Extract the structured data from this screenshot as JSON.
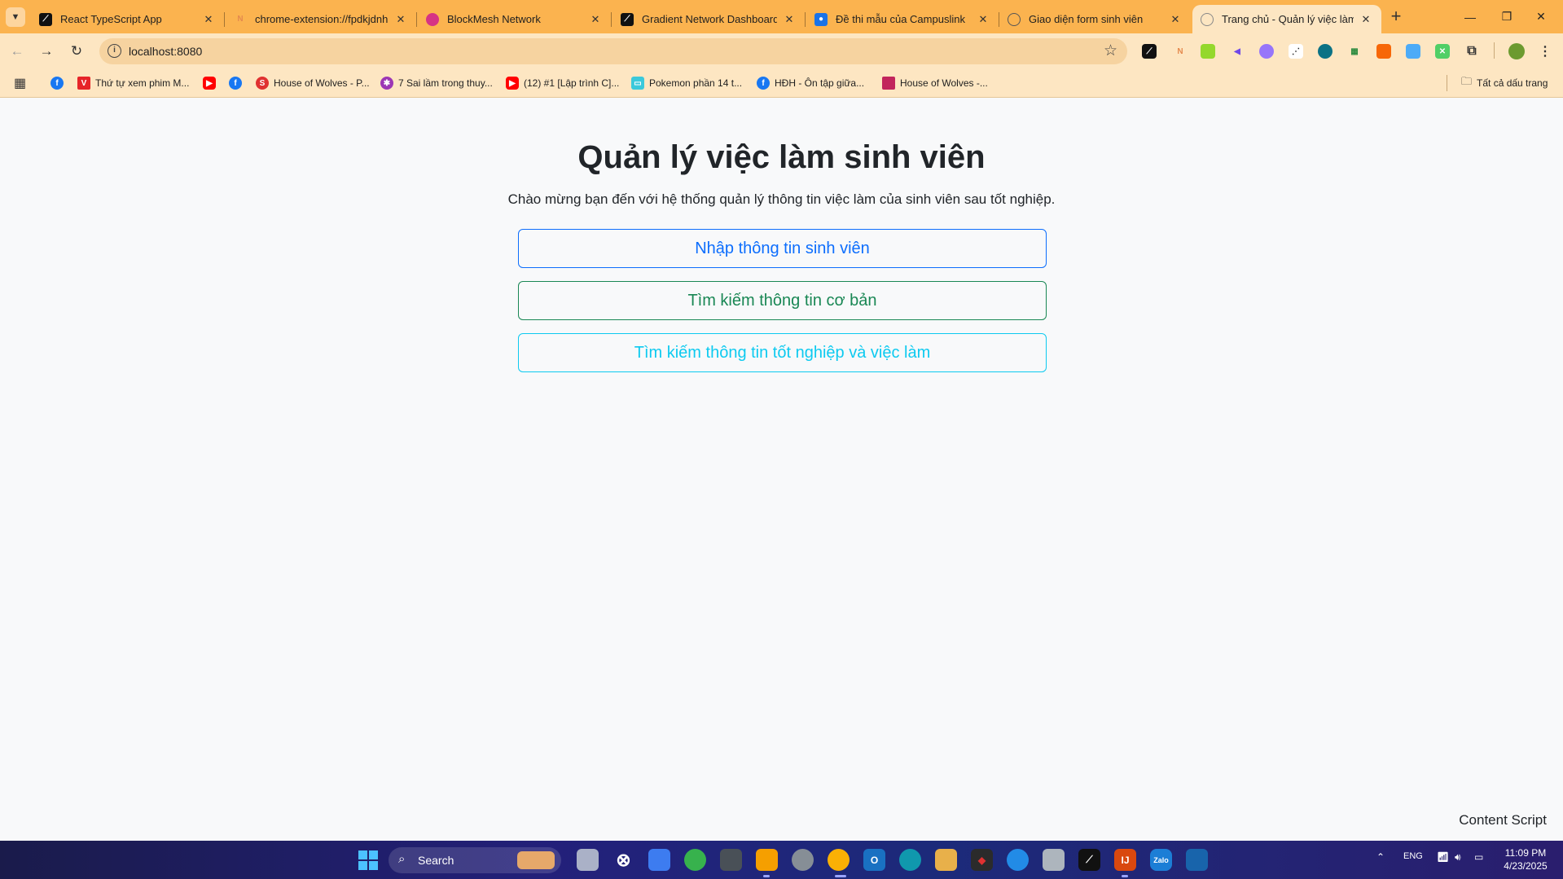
{
  "browser": {
    "tabs": [
      {
        "title": "React TypeScript App",
        "icon": "gradient-logo-icon",
        "color": "#111111"
      },
      {
        "title": "chrome-extension://fpdkjdnhkakefebpekbdhillbhonfjjp",
        "icon": "nodepay-icon",
        "color": "#f0a070"
      },
      {
        "title": "BlockMesh Network",
        "icon": "blockmesh-icon",
        "color": "#d63384"
      },
      {
        "title": "Gradient Network Dashboard",
        "icon": "gradient-logo-icon",
        "color": "#111111"
      },
      {
        "title": "Đề thi mẫu của Campuslink",
        "icon": "contact-icon",
        "color": "#1a73e8"
      },
      {
        "title": "Giao diện form sinh viên",
        "icon": "globe-icon",
        "color": "#666666"
      },
      {
        "title": "Trang chủ - Quản lý việc làm sinh viên",
        "icon": "globe-icon",
        "color": "#666666"
      }
    ],
    "address": "localhost:8080",
    "bookmarks": [
      {
        "label": "",
        "icon": "facebook-icon",
        "color": "#1877f2"
      },
      {
        "label": "Thứ tự xem phim M...",
        "icon": "marvel-icon",
        "color": "#e62429"
      },
      {
        "label": "",
        "icon": "youtube-icon",
        "color": "#ff0000"
      },
      {
        "label": "",
        "icon": "facebook-icon",
        "color": "#1877f2"
      },
      {
        "label": "House of Wolves - P...",
        "icon": "scribd-icon",
        "color": "#e03131"
      },
      {
        "label": "7 Sai lầm trong thuy...",
        "icon": "pinwheel-icon",
        "color": "#9c36b5"
      },
      {
        "label": "(12) #1 [Lập trình C]...",
        "icon": "youtube-icon",
        "color": "#ff0000"
      },
      {
        "label": "Pokemon phần 14 t...",
        "icon": "tv-icon",
        "color": "#3bc9db"
      },
      {
        "label": "HĐH - Ôn tập giữa...",
        "icon": "facebook-icon",
        "color": "#1877f2"
      },
      {
        "label": "House of Wolves -...",
        "icon": "image-icon",
        "color": "#c2255c"
      }
    ],
    "all_bookmarks": "Tất cả dấu trang"
  },
  "page": {
    "title": "Quản lý việc làm sinh viên",
    "welcome": "Chào mừng bạn đến với hệ thống quản lý thông tin việc làm của sinh viên sau tốt nghiệp.",
    "buttons": {
      "enter_info": "Nhập thông tin sinh viên",
      "basic_search": "Tìm kiếm thông tin cơ bản",
      "graduation_search": "Tìm kiếm thông tin tốt nghiệp và việc làm"
    },
    "content_script": "Content Script"
  },
  "taskbar": {
    "search": "Search",
    "lang": "ENG",
    "time": "11:09 PM",
    "date": "4/23/2025"
  }
}
